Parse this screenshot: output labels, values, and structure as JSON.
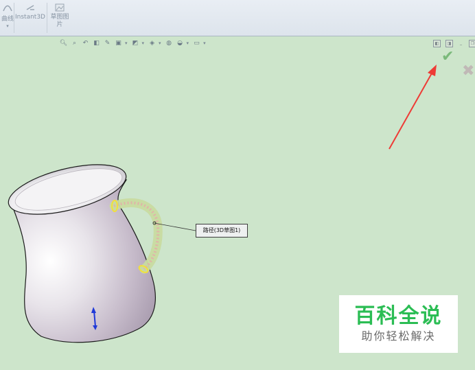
{
  "ribbon": {
    "items": [
      {
        "label": "曲线",
        "sub": "▾",
        "icon": "curve-icon"
      },
      {
        "label": "Instant3D",
        "icon": "instant3d-icon"
      },
      {
        "label": "草图图片",
        "icon": "sketch-picture-icon"
      }
    ]
  },
  "heads_up_toolbar": {
    "tools": [
      "zoom-to-fit-icon",
      "zoom-to-area-icon",
      "previous-view-icon",
      "section-view-icon",
      "dynamic-annotation-icon",
      "view-orientation-icon",
      "display-style-icon",
      "hide-show-icon",
      "edit-appearance-icon",
      "apply-scene-icon",
      "view-settings-icon"
    ]
  },
  "confirm_corner": {
    "ok_icon": "✔",
    "cancel_icon": "✖",
    "ok_color": "#7ab97a",
    "cancel_color": "#c0b9b6"
  },
  "callout": {
    "label": "路径(3D草图1)"
  },
  "colors": {
    "background": "#cde5cb",
    "arrow": "#ee3b36",
    "watermark": "#2bbd54"
  },
  "watermark": {
    "title": "百科全说",
    "subtitle": "助你轻松解决"
  }
}
